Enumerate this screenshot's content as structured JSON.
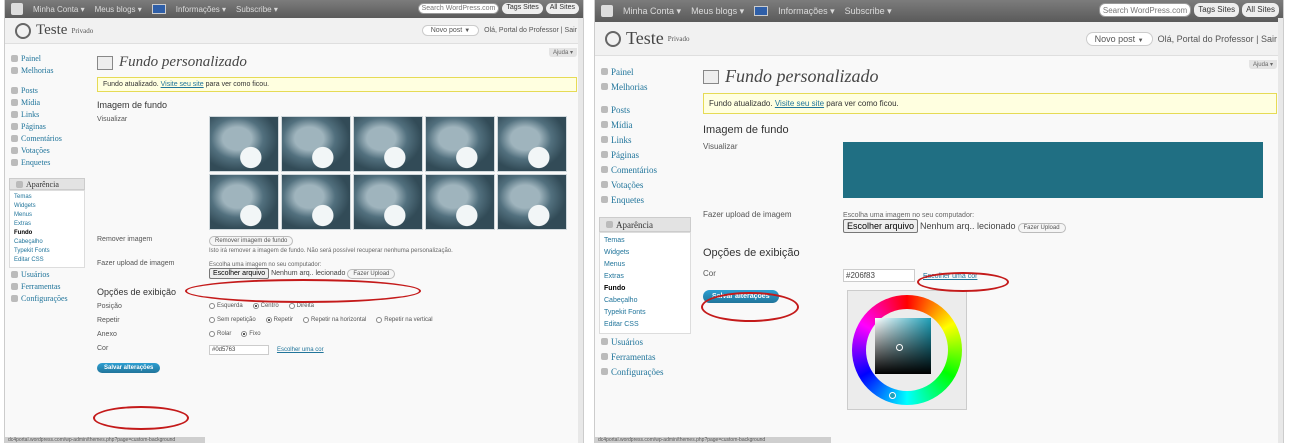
{
  "left": {
    "adminbar": {
      "items": [
        "Minha Conta ▾",
        "Meus blogs ▾",
        "Informações ▾",
        "Subscribe ▾"
      ],
      "search_placeholder": "Search WordPress.com",
      "btn1": "Tags Sites",
      "btn2": "All Sites"
    },
    "header": {
      "site_title": "Teste",
      "site_private": "Privado",
      "new_post": "Novo post",
      "greeting": "Olá, Portal do Professor | Sair"
    },
    "help_tab": "Ajuda ▾",
    "sidebar": {
      "items": [
        "Painel",
        "Melhorias"
      ],
      "items2": [
        "Posts",
        "Mídia",
        "Links",
        "Páginas",
        "Comentários",
        "Votações",
        "Enquetes"
      ],
      "appearance": "Aparência",
      "sub": [
        "Temas",
        "Widgets",
        "Menus",
        "Extras",
        "Fundo",
        "Cabeçalho",
        "Typekit Fonts",
        "Editar CSS"
      ],
      "items3": [
        "Usuários",
        "Ferramentas",
        "Configurações"
      ]
    },
    "page": {
      "title": "Fundo personalizado",
      "notice_text": "Fundo atualizado.",
      "notice_link": "Visite seu site",
      "notice_rest": "para ver como ficou.",
      "section1": "Imagem de fundo",
      "label_preview": "Visualizar",
      "label_remove": "Remover imagem",
      "btn_remove": "Remover imagem de fundo",
      "remove_hint": "Isto irá remover a imagem de fundo. Não será possível recuperar nenhuma personalização.",
      "label_upload": "Fazer upload de imagem",
      "upload_hint": "Escolha uma imagem no seu computador:",
      "btn_choose": "Escolher arquivo",
      "no_file": "Nenhum arq.. lecionado",
      "btn_upload": "Fazer Upload",
      "section2": "Opções de exibição",
      "label_position": "Posição",
      "pos_opts": [
        "Esquerda",
        "Centro",
        "Direita"
      ],
      "label_repeat": "Repetir",
      "rep_opts": [
        "Sem repetição",
        "Repetir",
        "Repetir na horizontal",
        "Repetir na vertical"
      ],
      "label_attach": "Anexo",
      "att_opts": [
        "Rolar",
        "Fixo"
      ],
      "label_color": "Cor",
      "color_value": "#0d5763",
      "color_link": "Escolher uma cor",
      "save": "Salvar alterações"
    },
    "status": "dc4portal.wordpress.com/wp-admin/themes.php?page=custom-background"
  },
  "right": {
    "adminbar": {
      "items": [
        "Minha Conta ▾",
        "Meus blogs ▾",
        "Informações ▾",
        "Subscribe ▾"
      ],
      "search_placeholder": "Search WordPress.com",
      "btn1": "Tags Sites",
      "btn2": "All Sites"
    },
    "header": {
      "site_title": "Teste",
      "site_private": "Privado",
      "new_post": "Novo post",
      "greeting": "Olá, Portal do Professor | Sair"
    },
    "help_tab": "Ajuda ▾",
    "sidebar": {
      "items": [
        "Painel",
        "Melhorias"
      ],
      "items2": [
        "Posts",
        "Mídia",
        "Links",
        "Páginas",
        "Comentários",
        "Votações",
        "Enquetes"
      ],
      "appearance": "Aparência",
      "sub": [
        "Temas",
        "Widgets",
        "Menus",
        "Extras",
        "Fundo",
        "Cabeçalho",
        "Typekit Fonts",
        "Editar CSS"
      ],
      "items3": [
        "Usuários",
        "Ferramentas",
        "Configurações"
      ]
    },
    "page": {
      "title": "Fundo personalizado",
      "notice_text": "Fundo atualizado.",
      "notice_link": "Visite seu site",
      "notice_rest": "para ver como ficou.",
      "section1": "Imagem de fundo",
      "label_preview": "Visualizar",
      "label_upload": "Fazer upload de imagem",
      "upload_hint": "Escolha uma imagem no seu computador:",
      "btn_choose": "Escolher arquivo",
      "no_file": "Nenhum arq.. lecionado",
      "btn_upload": "Fazer Upload",
      "section2": "Opções de exibição",
      "label_color": "Cor",
      "color_value": "#206f83",
      "color_link": "Escolher uma cor",
      "save": "Salvar alterações"
    },
    "status": "dc4portal.wordpress.com/wp-admin/themes.php?page=custom-background"
  },
  "colors": {
    "accent": "#21759b",
    "highlight_oval": "#c41a1a",
    "preview_bg": "#206f83"
  },
  "icons": [
    "wordpress-logo-icon",
    "flag-icon",
    "dashboard-icon",
    "posts-icon",
    "media-icon",
    "links-icon",
    "pages-icon",
    "comments-icon",
    "appearance-icon",
    "users-icon",
    "tools-icon",
    "settings-icon",
    "page-header-icon"
  ]
}
